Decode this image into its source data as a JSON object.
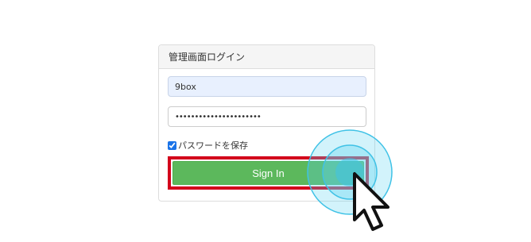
{
  "login_panel": {
    "title": "管理画面ログイン",
    "username": {
      "value": "9box"
    },
    "password": {
      "value": "••••••••••••••••••••••"
    },
    "remember": {
      "label": "パスワードを保存",
      "checked": true
    },
    "signin_button": {
      "label": "Sign In"
    }
  },
  "annotation": {
    "highlight_color": "#d3001b",
    "click_ripple_color": "#5fd3f0",
    "cursor_icon": "arrow-cursor-icon"
  },
  "colors": {
    "button_green": "#5cb85c",
    "autofill_blue": "#e8f0fe"
  }
}
